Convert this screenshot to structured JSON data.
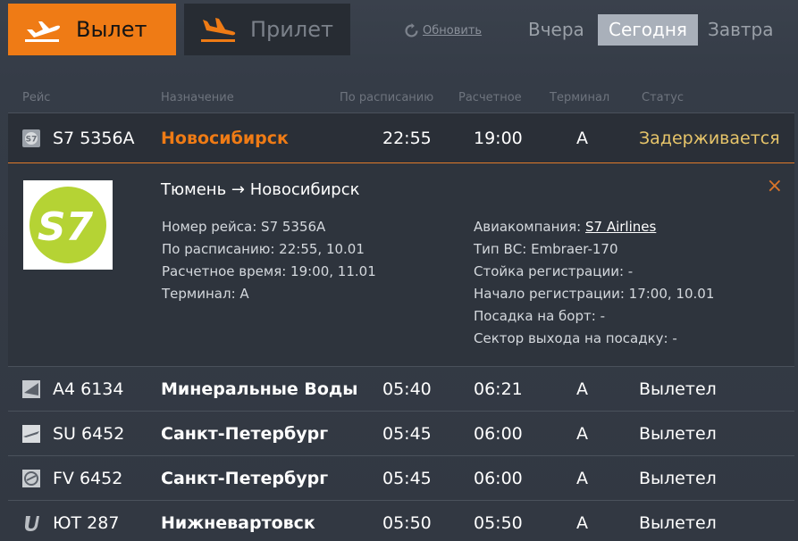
{
  "tabs": {
    "departure_label": "Вылет",
    "arrival_label": "Прилет"
  },
  "refresh_label": "Обновить",
  "days": {
    "yesterday": "Вчера",
    "today": "Сегодня",
    "tomorrow": "Завтра",
    "selected": "today"
  },
  "columns": {
    "flight": "Рейс",
    "destination": "Назначение",
    "scheduled": "По расписанию",
    "estimated": "Расчетное",
    "terminal": "Терминал",
    "status": "Статус"
  },
  "selected_flight": {
    "flight": "S7 5356A",
    "destination": "Новосибирск",
    "scheduled": "22:55",
    "estimated": "19:00",
    "terminal": "A",
    "status": "Задерживается",
    "logo_icon": "s7-logo-icon"
  },
  "detail": {
    "route": "Тюмень → Новосибирск",
    "logo_text": "S7",
    "logo_color": "#b5d334",
    "flight_number": "Номер рейса: S7 5356A",
    "scheduled": "По расписанию: 22:55, 10.01",
    "estimated": "Расчетное время: 19:00, 11.01",
    "terminal": "Терминал: A",
    "airline_label": "Авиакомпания: ",
    "airline_name": "S7 Airlines",
    "aircraft": "Тип ВС: Embraer-170",
    "checkin_desk": "Стойка регистрации: -",
    "checkin_start": "Начало регистрации: 17:00, 10.01",
    "boarding": "Посадка на борт: -",
    "gate": "Сектор выхода на посадку: -",
    "close_symbol": "×"
  },
  "flights": [
    {
      "flight": "A4 6134",
      "destination": "Минеральные Воды",
      "scheduled": "05:40",
      "estimated": "06:21",
      "terminal": "A",
      "status": "Вылетел",
      "logo_icon": "azimuth-logo-icon"
    },
    {
      "flight": "SU 6452",
      "destination": "Санкт-Петербург",
      "scheduled": "05:45",
      "estimated": "06:00",
      "terminal": "A",
      "status": "Вылетел",
      "logo_icon": "aeroflot-logo-icon"
    },
    {
      "flight": "FV 6452",
      "destination": "Санкт-Петербург",
      "scheduled": "05:45",
      "estimated": "06:00",
      "terminal": "A",
      "status": "Вылетел",
      "logo_icon": "rossiya-logo-icon"
    },
    {
      "flight": "ЮТ 287",
      "destination": "Нижневартовск",
      "scheduled": "05:50",
      "estimated": "05:50",
      "terminal": "A",
      "status": "Вылетел",
      "logo_icon": "utair-logo-icon"
    }
  ],
  "colors": {
    "accent": "#ef7b15",
    "delay": "#e7c56a",
    "today_bg": "#a9b0ba"
  }
}
